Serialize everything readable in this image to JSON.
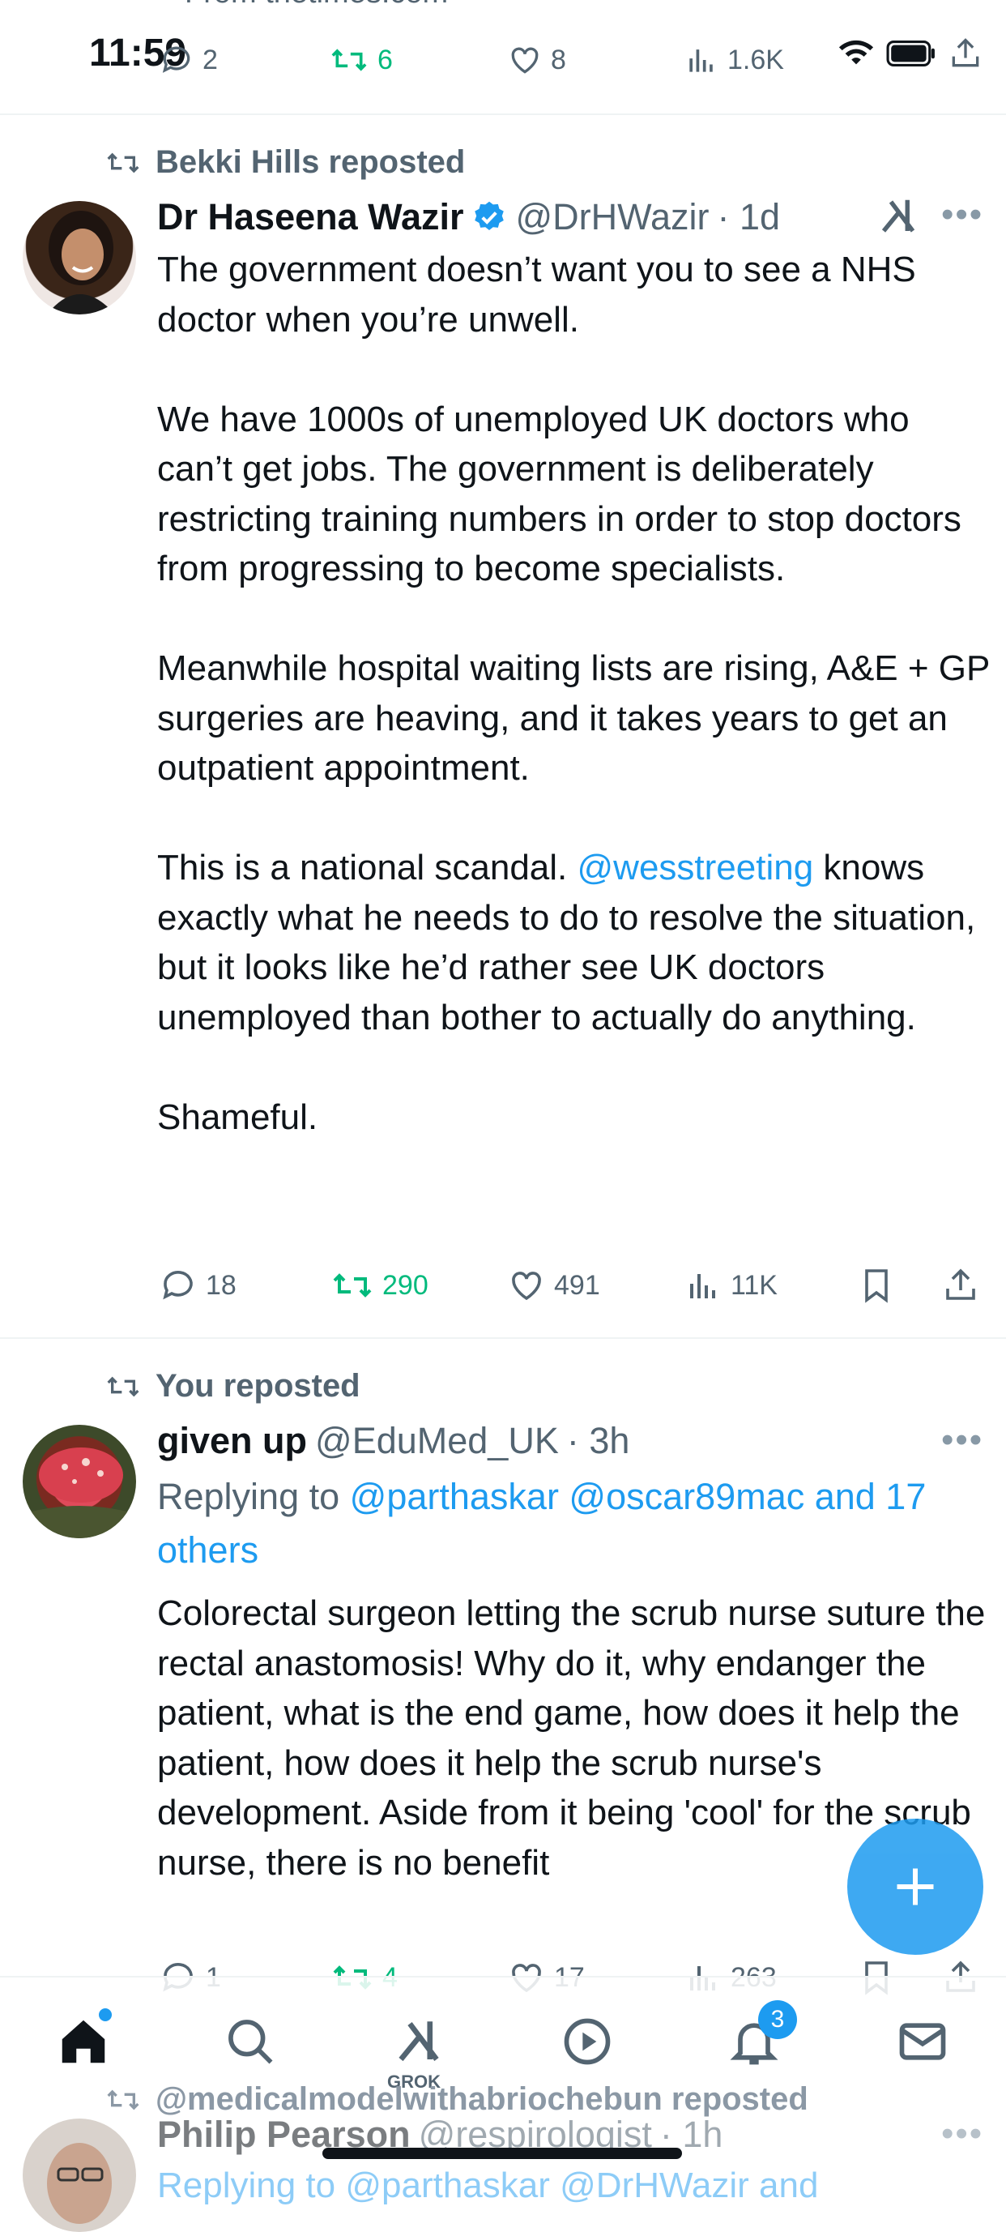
{
  "status_bar": {
    "time": "11:59"
  },
  "previous_tweet": {
    "source_text": "From thetimes.com",
    "stats": {
      "replies": "2",
      "reposts": "6",
      "likes": "8",
      "views": "1.6K"
    }
  },
  "tweets": [
    {
      "repost_by": "Bekki Hills reposted",
      "name": "Dr Haseena Wazir",
      "verified": true,
      "handle": "@DrHWazir",
      "time": "· 1d",
      "text_blocks": [
        "The government doesn’t want you to see a NHS doctor when you’re unwell.",
        "We have 1000s of unemployed UK doctors who can’t get jobs. The government is deliberately restricting training numbers in order to stop doctors from progressing to become specialists.",
        "Meanwhile hospital waiting lists are rising, A&E + GP surgeries are heaving, and it takes years to get an outpatient appointment."
      ],
      "scandal_prefix": "This is a national scandal. ",
      "mention": "@wesstreeting",
      "scandal_suffix": " knows exactly what he needs to do to resolve the situation, but it looks like he’d rather see UK doctors unemployed than bother to actually do anything.",
      "closing": "Shameful.",
      "stats": {
        "replies": "18",
        "reposts": "290",
        "likes": "491",
        "views": "11K"
      }
    },
    {
      "repost_by": "You reposted",
      "name": "given up",
      "handle": "@EduMed_UK",
      "time": "· 3h",
      "replying_prefix": "Replying to ",
      "replying_to": "@parthaskar @oscar89mac and 17 others",
      "text": "Colorectal surgeon letting the scrub nurse suture the rectal anastomosis! Why do it, why endanger the patient, what is the end game, how does it help the patient, how does it help the scrub nurse's development. Aside from it being 'cool' for the scrub nurse, there is no benefit",
      "stats": {
        "replies": "1",
        "reposts": "4",
        "likes": "17",
        "views": "263"
      }
    },
    {
      "repost_by": "@medicalmodelwithabriochebun reposted",
      "name": "Philip Pearson",
      "handle": "@respirologist",
      "time": "· 1h",
      "replying_preview": "Replying to @parthaskar @DrHWazir and"
    }
  ],
  "nav": {
    "grok_label": "GROK",
    "notifications_badge": "3"
  },
  "colors": {
    "accent": "#1d9bf0",
    "repost_green": "#00ba7c",
    "secondary_text": "#536471"
  }
}
